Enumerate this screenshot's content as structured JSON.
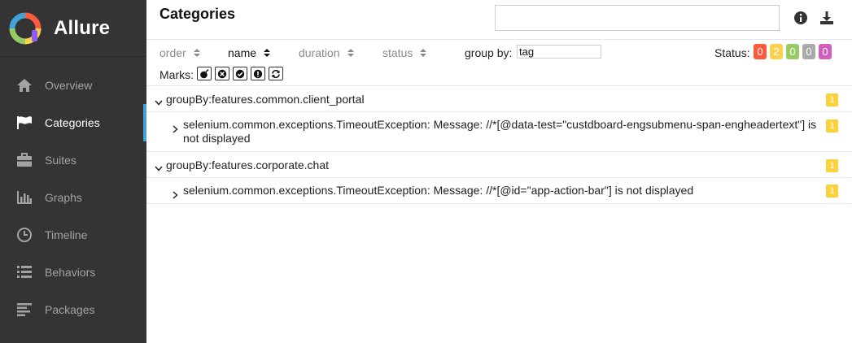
{
  "brand": {
    "name": "Allure"
  },
  "sidebar": {
    "items": [
      {
        "label": "Overview",
        "icon": "home-icon",
        "active": false
      },
      {
        "label": "Categories",
        "icon": "flag-icon",
        "active": true
      },
      {
        "label": "Suites",
        "icon": "briefcase-icon",
        "active": false
      },
      {
        "label": "Graphs",
        "icon": "bar-chart-icon",
        "active": false
      },
      {
        "label": "Timeline",
        "icon": "clock-icon",
        "active": false
      },
      {
        "label": "Behaviors",
        "icon": "list-icon",
        "active": false
      },
      {
        "label": "Packages",
        "icon": "align-left-icon",
        "active": false
      }
    ]
  },
  "header": {
    "title": "Categories",
    "search_value": ""
  },
  "toolbar": {
    "sort": [
      {
        "label": "order",
        "active": false
      },
      {
        "label": "name",
        "active": true
      },
      {
        "label": "duration",
        "active": false
      },
      {
        "label": "status",
        "active": false
      }
    ],
    "group_by_label": "group by:",
    "group_by_value": "tag",
    "status_label": "Status:",
    "status_counts": [
      {
        "status": "failed",
        "count": "0",
        "color": "#fd5a3e"
      },
      {
        "status": "broken",
        "count": "2",
        "color": "#ffd050"
      },
      {
        "status": "passed",
        "count": "0",
        "color": "#97cc64"
      },
      {
        "status": "skipped",
        "count": "0",
        "color": "#aaaaaa"
      },
      {
        "status": "unknown",
        "count": "0",
        "color": "#d35ebe"
      }
    ],
    "marks_label": "Marks:",
    "marks": [
      "flaky-bomb-icon",
      "new-failed-icon",
      "new-passed-icon",
      "new-broken-icon",
      "retries-icon"
    ]
  },
  "tree": {
    "groups": [
      {
        "name": "groupBy:features.common.client_portal",
        "count": "1",
        "children": [
          {
            "name": "selenium.common.exceptions.TimeoutException: Message: //*[@data-test=\"custdboard-engsubmenu-span-engheadertext\"] is not displayed",
            "count": "1"
          }
        ]
      },
      {
        "name": "groupBy:features.corporate.chat",
        "count": "1",
        "children": [
          {
            "name": "selenium.common.exceptions.TimeoutException: Message: //*[@id=\"app-action-bar\"] is not displayed",
            "count": "1"
          }
        ]
      }
    ]
  },
  "colors": {
    "sidebar_bg": "#343434",
    "active_accent": "#3ea3d8",
    "count_badge": "#fbd23e"
  }
}
